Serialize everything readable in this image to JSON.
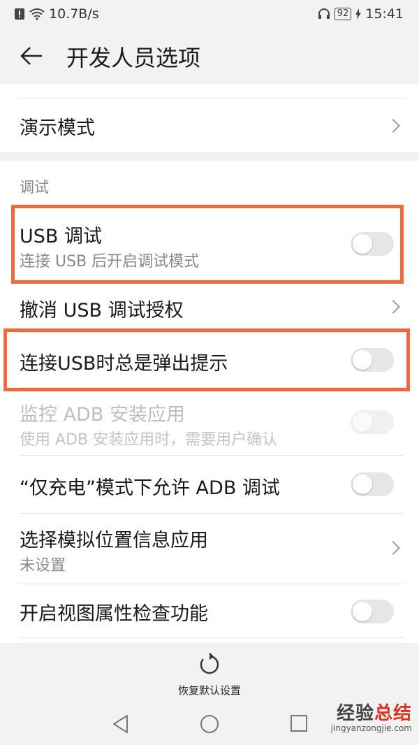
{
  "status_bar": {
    "speed": "10.7B/s",
    "battery": "92",
    "time": "15:41"
  },
  "header": {
    "title": "开发人员选项"
  },
  "rows": {
    "demo_mode": {
      "title": "演示模式"
    },
    "section_debug": "调试",
    "usb_debugging": {
      "title": "USB 调试",
      "subtitle": "连接 USB 后开启调试模式",
      "enabled": false
    },
    "revoke_usb": {
      "title": "撤消 USB 调试授权"
    },
    "usb_prompt": {
      "title": "连接USB时总是弹出提示",
      "enabled": false
    },
    "monitor_adb": {
      "title": "监控 ADB 安装应用",
      "subtitle": "使用 ADB 安装应用时，需要用户确认",
      "enabled": false,
      "disabled": true
    },
    "charge_only_adb": {
      "title": "“仅充电”模式下允许 ADB 调试",
      "enabled": false
    },
    "mock_location": {
      "title": "选择模拟位置信息应用",
      "subtitle": "未设置"
    },
    "view_attr": {
      "title": "开启视图属性检查功能",
      "enabled": false
    }
  },
  "bottom": {
    "reset_label": "恢复默认设置"
  },
  "watermark": {
    "brand_a": "经验",
    "brand_b": "总结",
    "url": "jingyanzongjie.com"
  },
  "colors": {
    "highlight": "#f0693b",
    "background": "#f2f2f2"
  },
  "icons": [
    "back-arrow-icon",
    "chevron-right-icon",
    "reset-icon",
    "nav-back-icon",
    "nav-home-icon",
    "nav-recent-icon"
  ]
}
